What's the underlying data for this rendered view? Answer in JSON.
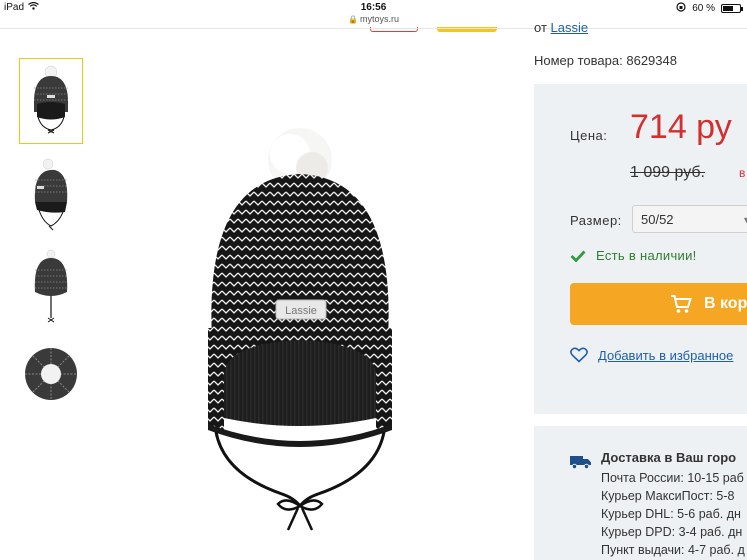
{
  "status_bar": {
    "device": "iPad",
    "time": "16:56",
    "battery": "60 %"
  },
  "browser": {
    "url": "mytoys.ru"
  },
  "product": {
    "brand_prefix": "от",
    "brand": "Lassie",
    "sku_label": "Номер товара:",
    "sku": "8629348",
    "thumbnails": [
      "thumb-front",
      "thumb-side",
      "thumb-back",
      "thumb-top"
    ],
    "hat_label": "Lassie"
  },
  "price_box": {
    "price_label": "Цена:",
    "price": "714 ру",
    "old_price": "1 099 руб.",
    "discount_fragment": "в",
    "size_label": "Размер:",
    "size_value": "50/52",
    "in_stock": "Есть в наличии!",
    "cart_button": "В кор",
    "favorite": "Добавить в избранное"
  },
  "delivery": {
    "title": "Доставка в Ваш горо",
    "items": [
      "Почта России: 10-15 раб",
      "Курьер МаксиПост: 5-8",
      "Курьер DHL: 5-6 раб. дн",
      "Курьер DPD: 3-4 раб. дн",
      "Пункт выдачи: 4-7 раб. д"
    ]
  },
  "colors": {
    "price_red": "#d32f2f",
    "link_blue": "#1e5fa8",
    "cart_orange": "#f5a623",
    "stock_green": "#2e7d32",
    "active_thumb_border": "#f2c417",
    "panel_bg": "#eef1f4"
  }
}
